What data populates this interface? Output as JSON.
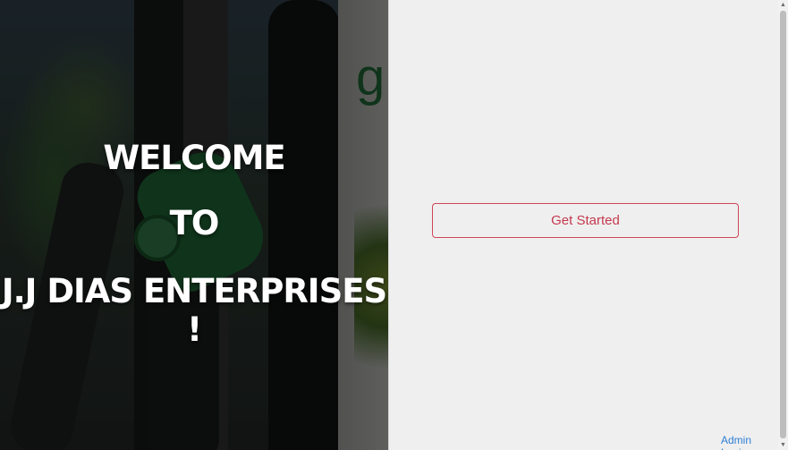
{
  "hero": {
    "line1": "WELCOME",
    "line2": "TO",
    "line3": "J.J DIAS ENTERPRISES !"
  },
  "actions": {
    "get_started": "Get Started",
    "admin_login": "Admin Login"
  },
  "colors": {
    "accent": "#c53a4e",
    "link": "#2f7fd4",
    "panel_bg": "#efefef"
  },
  "icons": {
    "scroll_up": "triangle-up-icon",
    "scroll_down": "triangle-down-icon"
  }
}
